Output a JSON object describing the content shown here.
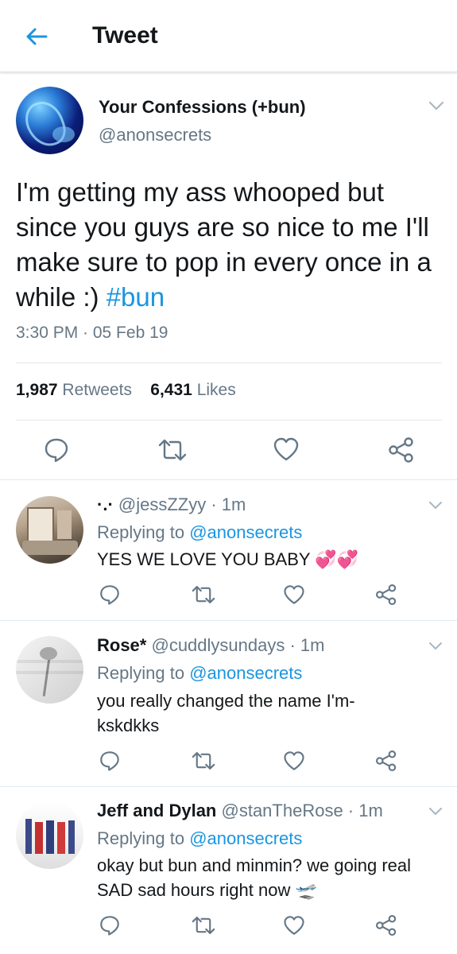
{
  "header": {
    "title": "Tweet"
  },
  "main_tweet": {
    "display_name": "Your Confessions (+bun)",
    "handle": "@anonsecrets",
    "text": "I'm getting my ass whooped but since you guys are so nice to me I'll make sure to pop in every once in a while :) ",
    "hashtag": "#bun",
    "timestamp": "3:30 PM · 05 Feb 19",
    "retweets_count": "1,987",
    "retweets_label": "Retweets",
    "likes_count": "6,431",
    "likes_label": "Likes"
  },
  "replies": [
    {
      "display_name": "·.·",
      "handle": "@jessZZyy",
      "time": "1m",
      "replying_prefix": "Replying to",
      "replying_to": "@anonsecrets",
      "text": "YES WE LOVE YOU BABY",
      "emoji": "💞💞"
    },
    {
      "display_name": "Rose*",
      "handle": "@cuddlysundays",
      "time": "1m",
      "replying_prefix": "Replying to",
      "replying_to": "@anonsecrets",
      "text": "you really changed the name I'm-kskdkks",
      "emoji": ""
    },
    {
      "display_name": "Jeff and Dylan",
      "handle": "@stanTheRose",
      "time": "1m",
      "replying_prefix": "Replying to",
      "replying_to": "@anonsecrets",
      "text": "okay but bun and minmin? we going real SAD sad hours right now",
      "emoji": "🛫"
    }
  ],
  "colors": {
    "accent": "#1b95e0",
    "secondary_text": "#657786",
    "primary_text": "#14171a",
    "divider": "#e1e8ed"
  },
  "icons": {
    "back": "arrow-left-icon",
    "menu": "chevron-down-icon",
    "reply": "reply-icon",
    "retweet": "retweet-icon",
    "like": "heart-icon",
    "share": "share-icon"
  }
}
